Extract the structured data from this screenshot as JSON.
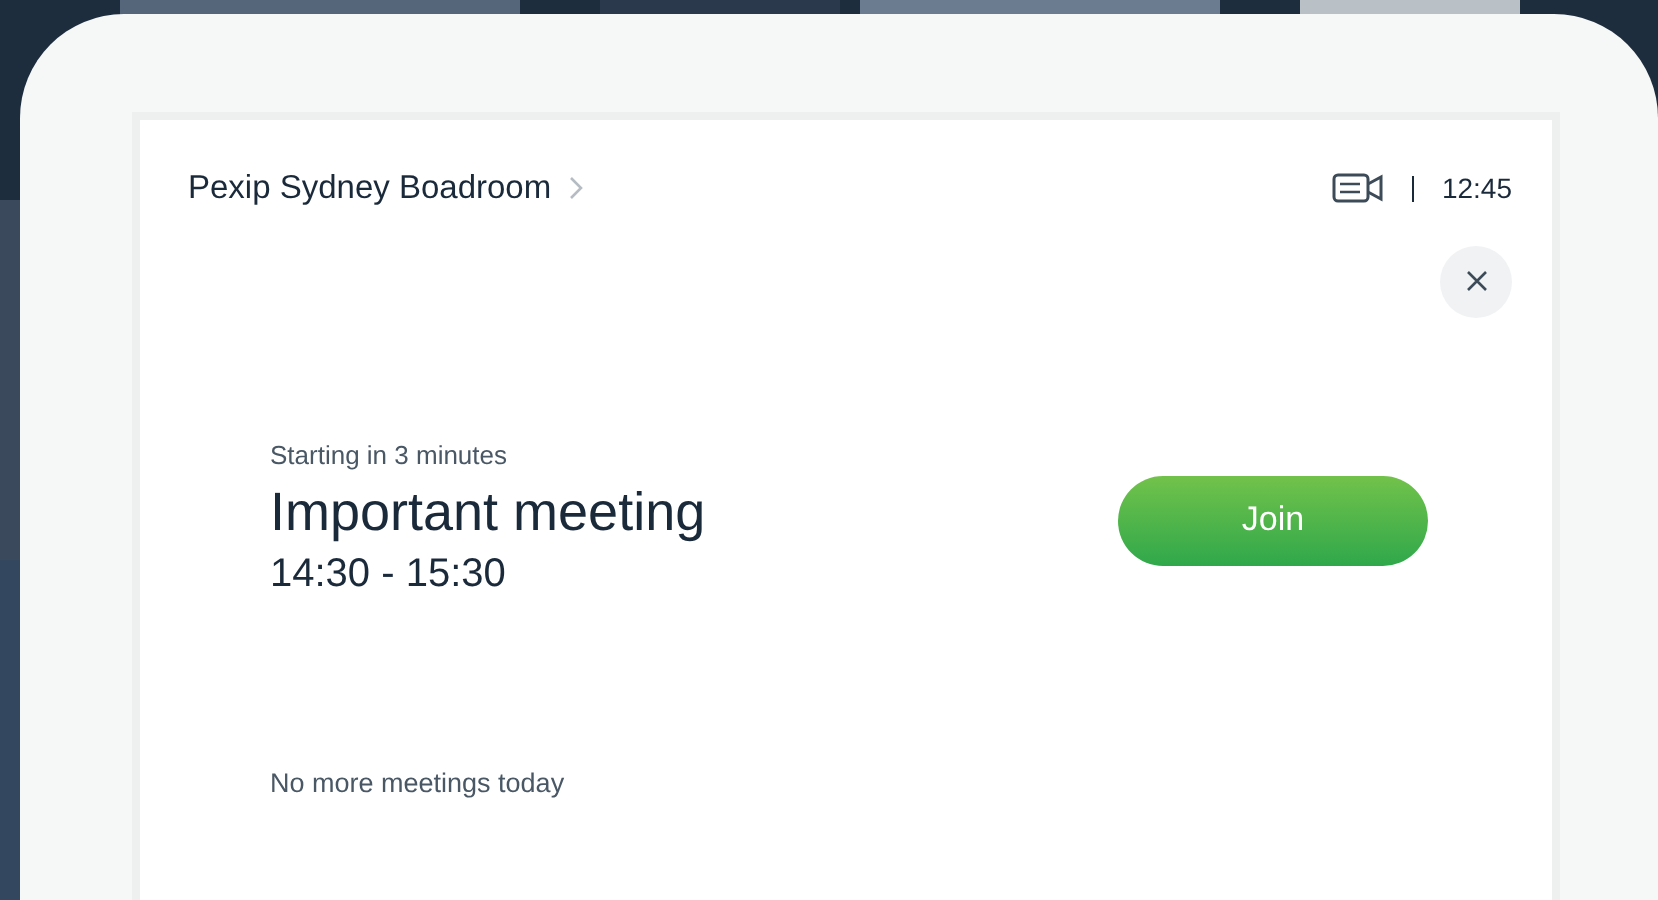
{
  "header": {
    "room_name": "Pexip Sydney Boadroom",
    "clock": "12:45"
  },
  "meeting": {
    "status": "Starting in 3 minutes",
    "title": "Important meeting",
    "time": "14:30 - 15:30",
    "join_label": "Join"
  },
  "footer_note": "No more meetings today"
}
